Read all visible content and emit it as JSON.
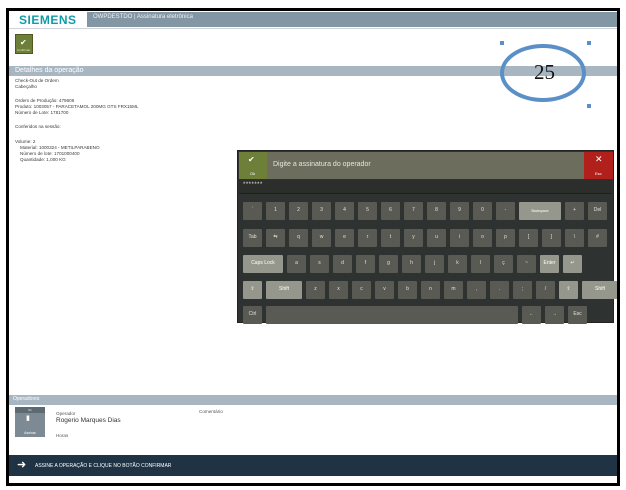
{
  "header": {
    "logo": "SIEMENS",
    "title": "OWPDESTDO | Assinatura eletrônica"
  },
  "toolbar": {
    "confirm_icon": "check-icon",
    "confirm_label": "Confirmar"
  },
  "details": {
    "section_title": "Detalhes da operação",
    "lines": [
      "Check-Out de Ordem",
      "Cabeçalho",
      "",
      "Ordem de Produção: 479606",
      "Produto: 1003057 - PARACETAMOL 200MG GTS FRX15ML",
      "Número de Lote: 1781700",
      "",
      "Conferidos na sessão:",
      "",
      "Volume: 2"
    ],
    "volume_lines": [
      "Material: 1000324 - METILPARABENO",
      "Número de lote: 1701000400",
      "Quantidade: 1,000 KG"
    ]
  },
  "badge": {
    "number": "25",
    "color": "#5b8fc7"
  },
  "keyboard": {
    "ok_label": "Ok",
    "ok_icon": "check-icon",
    "esc_label": "Esc",
    "esc_icon": "close-icon",
    "prompt": "Digite a assinatura do operador",
    "input_value": "*******",
    "rows": [
      [
        "`",
        "1",
        "2",
        "3",
        "4",
        "5",
        "6",
        "7",
        "8",
        "9",
        "0",
        "-",
        "Backspace",
        "+",
        "Del"
      ],
      [
        "Tab",
        "⇆",
        "q",
        "w",
        "e",
        "r",
        "t",
        "y",
        "u",
        "i",
        "o",
        "p",
        "[",
        "]",
        "\\",
        "#"
      ],
      [
        "Caps Lock",
        "a",
        "s",
        "d",
        "f",
        "g",
        "h",
        "j",
        "k",
        "l",
        "ç",
        "~",
        "Enter",
        "↵"
      ],
      [
        "⇧",
        "Shift",
        "z",
        "x",
        "c",
        "v",
        "b",
        "n",
        "m",
        ",",
        ".",
        ";",
        "/",
        "⇧",
        "Shift"
      ],
      [
        "Ctrl",
        "",
        "←",
        "→",
        "Esc"
      ]
    ],
    "colors": {
      "panel": "#2e3230",
      "key": "#595a53",
      "key_light": "#96978c",
      "ok": "#6d7f38",
      "esc": "#b2201c"
    }
  },
  "operators": {
    "section_title": "Operadores",
    "icon_tag": "S1",
    "icon_label": "Assinar",
    "operator_label": "Operador",
    "operator_name": "Rogerio Marques Dias",
    "time_label": "Horas",
    "comment_label": "Comentário"
  },
  "footer": {
    "arrow_icon": "arrow-right-icon",
    "message": "ASSINE A OPERAÇÃO E CLIQUE NO BOTÃO CONFIRMAR"
  }
}
